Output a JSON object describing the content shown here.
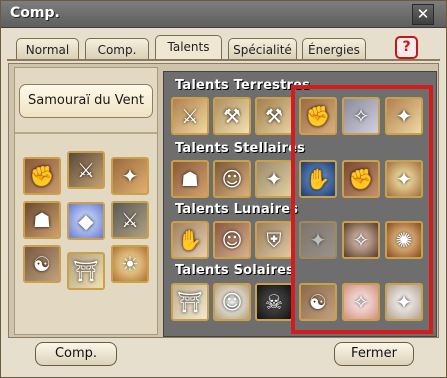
{
  "window": {
    "title": "Comp.",
    "close_label": "✕"
  },
  "tabs": [
    {
      "label": "Normal",
      "active": false
    },
    {
      "label": "Comp.",
      "active": false
    },
    {
      "label": "Talents",
      "active": true
    },
    {
      "label": "Spécialité",
      "active": false
    },
    {
      "label": "Énergies",
      "active": false
    }
  ],
  "help_label": "?",
  "class_name": "Samouraï du Vent",
  "sections": [
    {
      "title": "Talents Terrestres"
    },
    {
      "title": "Talents Stellaires"
    },
    {
      "title": "Talents Lunaires"
    },
    {
      "title": "Talents Solaires"
    }
  ],
  "colors": {
    "highlight": "#d41c1c",
    "icon_border": "#caa04a",
    "panel": "#6e6e6e"
  },
  "buttons": {
    "comp": "Comp.",
    "close": "Fermer"
  }
}
